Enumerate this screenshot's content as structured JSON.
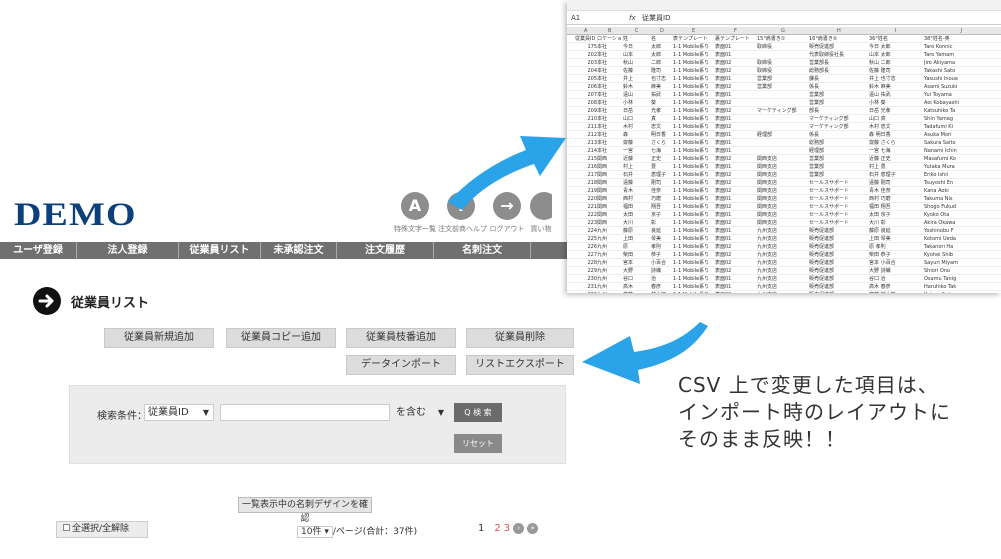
{
  "app": {
    "logo": "DEMO",
    "top_icons": [
      {
        "glyph": "A",
        "label": "特殊文字一覧",
        "icon": "font-icon"
      },
      {
        "glyph": "i",
        "label": "注文前商ヘルプ",
        "icon": "info-icon"
      },
      {
        "glyph": "→",
        "label": "ログアウト",
        "icon": "logout-icon"
      },
      {
        "glyph": "",
        "label": "買い物",
        "icon": "cart-icon"
      }
    ],
    "nav": [
      "ユーザ登録",
      "法人登録",
      "従業員リスト",
      "未承認注文",
      "注文履歴",
      "名刺注文"
    ],
    "page_title": "従業員リスト",
    "buttons": {
      "new_add": "従業員新規追加",
      "copy_add": "従業員コピー追加",
      "branch_add": "従業員枝番追加",
      "delete": "従業員削除",
      "import": "データインポート",
      "export": "リストエクスポート"
    },
    "search": {
      "label": "検索条件：",
      "field_select": "従業員ID",
      "operator_select": "を含む",
      "search_button": "Q 検 索",
      "reset_button": "リセット"
    },
    "confirm_design_button": "一覧表示中の名刺デザインを確認",
    "select_all_label": "全選択/全解除",
    "per_page": {
      "select": "10件",
      "suffix": "/ページ(合計：37件)"
    },
    "pagination": {
      "current": "1",
      "pages": [
        "2",
        "3"
      ]
    }
  },
  "sheet": {
    "cell_ref": "A1",
    "formula": "従業員ID",
    "columns": [
      "A",
      "B",
      "C",
      "D",
      "E",
      "F",
      "G",
      "H",
      "I",
      "J"
    ],
    "header": [
      "従業員ID",
      "ロケーション",
      "姓",
      "名",
      "表テンプレート",
      "裏テンプレート",
      "15°肩書き①",
      "16°肩書き②",
      "36°姓名",
      "38°姓名-英"
    ],
    "rows": [
      [
        "175",
        "本社",
        "今日",
        "太郎",
        "1-1 Mobile系り",
        "表面01",
        "取締役",
        "販売促進部",
        "今日 太郎",
        "Taro Konnic"
      ],
      [
        "202",
        "本社",
        "山本",
        "太郎",
        "1-1 Mobile系り",
        "表面01",
        "",
        "代表取締役社長",
        "山本 太郎",
        "Taro Yamam"
      ],
      [
        "203",
        "本社",
        "秋山",
        "二郎",
        "1-1 Mobile系り",
        "表面02",
        "取締役",
        "営業部長",
        "秋山 二郎",
        "Jiro Akiyama"
      ],
      [
        "204",
        "本社",
        "佐藤",
        "隆司",
        "1-1 Mobile系り",
        "表面02",
        "取締役",
        "総務部長",
        "佐藤 隆司",
        "Takashi Sato"
      ],
      [
        "205",
        "本社",
        "井上",
        "也寸志",
        "1-1 Mobile系り",
        "表面01",
        "営業部",
        "課長",
        "井上 也寸志",
        "Yasushi Inoue"
      ],
      [
        "206",
        "本社",
        "鈴木",
        "麻美",
        "1-1 Mobile系り",
        "表面02",
        "営業部",
        "係長",
        "鈴木 麻美",
        "Asami Suzuki"
      ],
      [
        "207",
        "本社",
        "遠山",
        "祐武",
        "1-1 Mobile系り",
        "表面01",
        "",
        "営業部",
        "遠山 祐武",
        "Yui Toyama"
      ],
      [
        "208",
        "本社",
        "小林",
        "葵",
        "1-1 Mobile系り",
        "表面02",
        "",
        "営業部",
        "小林 葵",
        "Aoi Kobayashi"
      ],
      [
        "209",
        "本社",
        "日岳",
        "光孝",
        "1-1 Mobile系り",
        "表面02",
        "マーケティング部",
        "部長",
        "日岳 光孝",
        "Katsuhiko Ta"
      ],
      [
        "210",
        "本社",
        "山口",
        "真",
        "1-1 Mobile系り",
        "表面01",
        "",
        "マーケティング部",
        "山口 真",
        "Shin Yamag"
      ],
      [
        "211",
        "本社",
        "木村",
        "忠文",
        "1-1 Mobile系り",
        "表面02",
        "",
        "マーケティング部",
        "木村 忠文",
        "Tadafumi Ki"
      ],
      [
        "212",
        "本社",
        "森",
        "明日香",
        "1-1 Mobile系り",
        "表面01",
        "経理部",
        "係長",
        "森 明日香",
        "Asuka Mori"
      ],
      [
        "213",
        "本社",
        "齋藤",
        "さくら",
        "1-1 Mobile系り",
        "表面01",
        "",
        "総務部",
        "齋藤 さくら",
        "Sakura Saito"
      ],
      [
        "214",
        "本社",
        "一宮",
        "七海",
        "1-1 Mobile系り",
        "表面01",
        "",
        "経理部",
        "一宮 七海",
        "Nanami Ichin"
      ],
      [
        "215",
        "関西",
        "近藤",
        "正史",
        "1-1 Mobile系り",
        "表面02",
        "関西支店",
        "営業部",
        "近藤 正史",
        "Masafumi Ko"
      ],
      [
        "216",
        "関西",
        "村上",
        "豊",
        "1-1 Mobile系り",
        "表面01",
        "関西支店",
        "営業部",
        "村上 豊",
        "Yutaka Mura"
      ],
      [
        "217",
        "関西",
        "石井",
        "恵理子",
        "1-1 Mobile系り",
        "表面02",
        "関西支店",
        "営業部",
        "石井 恵理子",
        "Eriko Ishii"
      ],
      [
        "218",
        "関西",
        "遠藤",
        "剛司",
        "1-1 Mobile系り",
        "表面02",
        "関西支店",
        "セールスサポート",
        "遠藤 剛司",
        "Tsuyoshi En"
      ],
      [
        "219",
        "関西",
        "青木",
        "佳奈",
        "1-1 Mobile系り",
        "表面02",
        "関西支店",
        "セールスサポート",
        "青木 佳奈",
        "Kana Aoki"
      ],
      [
        "220",
        "関西",
        "西村",
        "巧磨",
        "1-1 Mobile系り",
        "表面01",
        "関西支店",
        "セールスサポート",
        "西村 巧磨",
        "Takuma Nis"
      ],
      [
        "221",
        "関西",
        "福田",
        "翔吾",
        "1-1 Mobile系り",
        "表面02",
        "関西支店",
        "セールスサポート",
        "福田 翔吾",
        "Shogo Fukud"
      ],
      [
        "222",
        "関西",
        "太田",
        "京子",
        "1-1 Mobile系り",
        "表面01",
        "関西支店",
        "セールスサポート",
        "太田 京子",
        "Kyoko Ota"
      ],
      [
        "223",
        "関西",
        "大川",
        "彰",
        "1-1 Mobile系り",
        "表面02",
        "関西支店",
        "セールスサポート",
        "大川 彰",
        "Akira Okawa"
      ],
      [
        "224",
        "九州",
        "藤原",
        "良延",
        "1-1 Mobile系り",
        "表面01",
        "九州支店",
        "販売促進部",
        "藤原 良延",
        "Yoshinobu F"
      ],
      [
        "225",
        "九州",
        "上田",
        "琴美",
        "1-1 Mobile系り",
        "表面01",
        "九州支店",
        "販売促進部",
        "上田 琴美",
        "Kotomi Ueda"
      ],
      [
        "226",
        "九州",
        "原",
        "孝則",
        "1-1 Mobile系り",
        "表面02",
        "九州支店",
        "販売促進部",
        "原 孝則",
        "Takanori Ha"
      ],
      [
        "227",
        "九州",
        "柴田",
        "恭子",
        "1-1 Mobile系り",
        "表面02",
        "九州支店",
        "販売促進部",
        "柴田 恭子",
        "Kyohei Shib"
      ],
      [
        "228",
        "九州",
        "宮本",
        "小百合",
        "1-1 Mobile系り",
        "表面02",
        "九州支店",
        "販売促進部",
        "宮本 小百合",
        "Sayuri Miyam"
      ],
      [
        "229",
        "九州",
        "大野",
        "詩織",
        "1-1 Mobile系り",
        "表面02",
        "九州支店",
        "販売促進部",
        "大野 詩織",
        "Shiori Ono"
      ],
      [
        "230",
        "九州",
        "谷口",
        "治",
        "1-1 Mobile系り",
        "表面01",
        "九州支店",
        "販売促進部",
        "谷口 治",
        "Osamu Tanig"
      ],
      [
        "231",
        "九州",
        "高木",
        "春彦",
        "1-1 Mobile系り",
        "表面01",
        "九州支店",
        "販売促進部",
        "高木 春彦",
        "Haruhiko Tak"
      ],
      [
        "232",
        "九州",
        "斉藤",
        "林太郎",
        "1-1 Mobile系り",
        "表面02",
        "九州支店",
        "販売促進部",
        "斉藤 林太郎",
        "Kotaro Saito"
      ]
    ]
  },
  "caption": {
    "line1": "CSV 上で変更した項目は、",
    "line2": "インポート時のレイアウトに",
    "line3": "そのまま反映！！"
  },
  "colors": {
    "accent_blue": "#2aa3e8",
    "nav_gray": "#707070",
    "logo_blue": "#0d3f7a"
  }
}
